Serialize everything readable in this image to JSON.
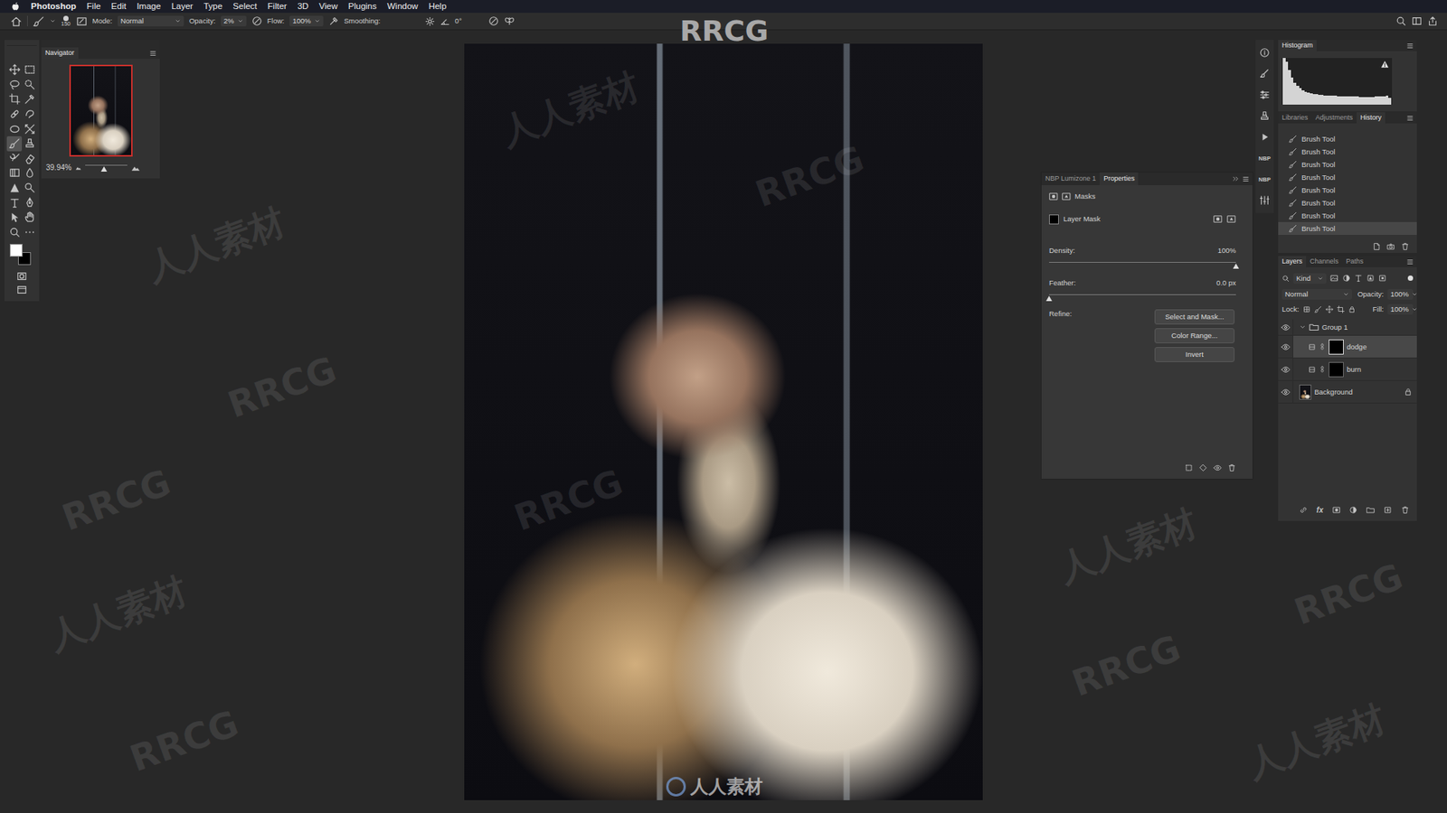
{
  "menubar": {
    "items": [
      "Photoshop",
      "File",
      "Edit",
      "Image",
      "Layer",
      "Type",
      "Select",
      "Filter",
      "3D",
      "View",
      "Plugins",
      "Window",
      "Help"
    ]
  },
  "options": {
    "brush_size": "150",
    "mode_label": "Mode:",
    "mode": "Normal",
    "opacity_label": "Opacity:",
    "opacity": "2%",
    "flow_label": "Flow:",
    "flow": "100%",
    "smoothing_label": "Smoothing:",
    "angle": "0°"
  },
  "toolbar": {
    "tools": [
      {
        "selected": false
      },
      {
        "selected": false
      },
      {
        "selected": false
      },
      {
        "selected": false
      },
      {
        "selected": false
      },
      {
        "selected": false
      },
      {
        "selected": false
      },
      {
        "selected": false
      },
      {
        "selected": false
      },
      {
        "selected": false
      },
      {
        "selected": true
      },
      {
        "selected": false
      },
      {
        "selected": false
      },
      {
        "selected": false
      },
      {
        "selected": false
      },
      {
        "selected": false
      },
      {
        "selected": false
      },
      {
        "selected": false
      },
      {
        "selected": false
      },
      {
        "selected": false
      },
      {
        "selected": false
      },
      {
        "selected": false
      },
      {
        "selected": false
      },
      {
        "selected": false
      }
    ],
    "swatches": [
      {
        "color": "#ffffff"
      },
      {
        "color": "#000000"
      }
    ]
  },
  "navigator": {
    "title": "Navigator",
    "zoom": "39.94%",
    "level": 0.45
  },
  "dock": {
    "labels": [
      "NBP",
      "NBP"
    ]
  },
  "histogram": {
    "title": "Histogram",
    "values": [
      100,
      92,
      74,
      58,
      47,
      40,
      35,
      31,
      28,
      26,
      24,
      23,
      22,
      21,
      21,
      20,
      20,
      19,
      19,
      19,
      18,
      18,
      18,
      18,
      17,
      17,
      17,
      17,
      16,
      16,
      16,
      16,
      16,
      16,
      17,
      17,
      18,
      18,
      20,
      14
    ]
  },
  "history": {
    "tabs": [
      {
        "label": "Libraries",
        "selected": false
      },
      {
        "label": "Adjustments",
        "selected": false
      },
      {
        "label": "History",
        "selected": true
      }
    ],
    "items": [
      {
        "label": "Brush Tool",
        "selected": false
      },
      {
        "label": "Brush Tool",
        "selected": false
      },
      {
        "label": "Brush Tool",
        "selected": false
      },
      {
        "label": "Brush Tool",
        "selected": false
      },
      {
        "label": "Brush Tool",
        "selected": false
      },
      {
        "label": "Brush Tool",
        "selected": false
      },
      {
        "label": "Brush Tool",
        "selected": false
      },
      {
        "label": "Brush Tool",
        "selected": true
      }
    ]
  },
  "properties": {
    "tabs": [
      {
        "label": "NBP Lumizone 1",
        "selected": false
      },
      {
        "label": "Properties",
        "selected": true
      }
    ],
    "section": "Masks",
    "mask_label": "Layer Mask",
    "density_label": "Density:",
    "density": "100%",
    "density_level": 1,
    "feather_label": "Feather:",
    "feather": "0.0 px",
    "feather_level": 0,
    "refine_label": "Refine:",
    "buttons": [
      "Select and Mask...",
      "Color Range...",
      "Invert"
    ]
  },
  "layers": {
    "tabs": [
      {
        "label": "Layers",
        "selected": true
      },
      {
        "label": "Channels",
        "selected": false
      },
      {
        "label": "Paths",
        "selected": false
      }
    ],
    "filter": "Kind",
    "blend_mode": "Normal",
    "opacity_label": "Opacity:",
    "opacity": "100%",
    "lock_label": "Lock:",
    "fill_label": "Fill:",
    "fill": "100%",
    "fx": "fx",
    "items": [
      {
        "name": "Group 1",
        "kind": "group",
        "visible": true,
        "expanded": true,
        "selected": false,
        "in_group": false,
        "locked": false
      },
      {
        "name": "dodge",
        "kind": "mask",
        "visible": true,
        "selected": true,
        "in_group": true,
        "locked": false
      },
      {
        "name": "burn",
        "kind": "mask",
        "visible": true,
        "selected": false,
        "in_group": true,
        "locked": false
      },
      {
        "name": "Background",
        "kind": "background",
        "visible": true,
        "selected": false,
        "in_group": false,
        "locked": true
      }
    ]
  },
  "watermarks": [
    {
      "text": "RRCG"
    },
    {
      "text": "人人素材"
    },
    {
      "text": "人人素材"
    },
    {
      "text": "RRCG"
    },
    {
      "text": "人人素材"
    },
    {
      "text": "RRCG"
    },
    {
      "text": "RRCG"
    },
    {
      "text": "RRCG"
    },
    {
      "text": "人人素材"
    },
    {
      "text": "人人素材"
    },
    {
      "text": "RRCG"
    },
    {
      "text": "RRCG"
    },
    {
      "text": "人人素材"
    },
    {
      "text": "RRCG"
    }
  ]
}
